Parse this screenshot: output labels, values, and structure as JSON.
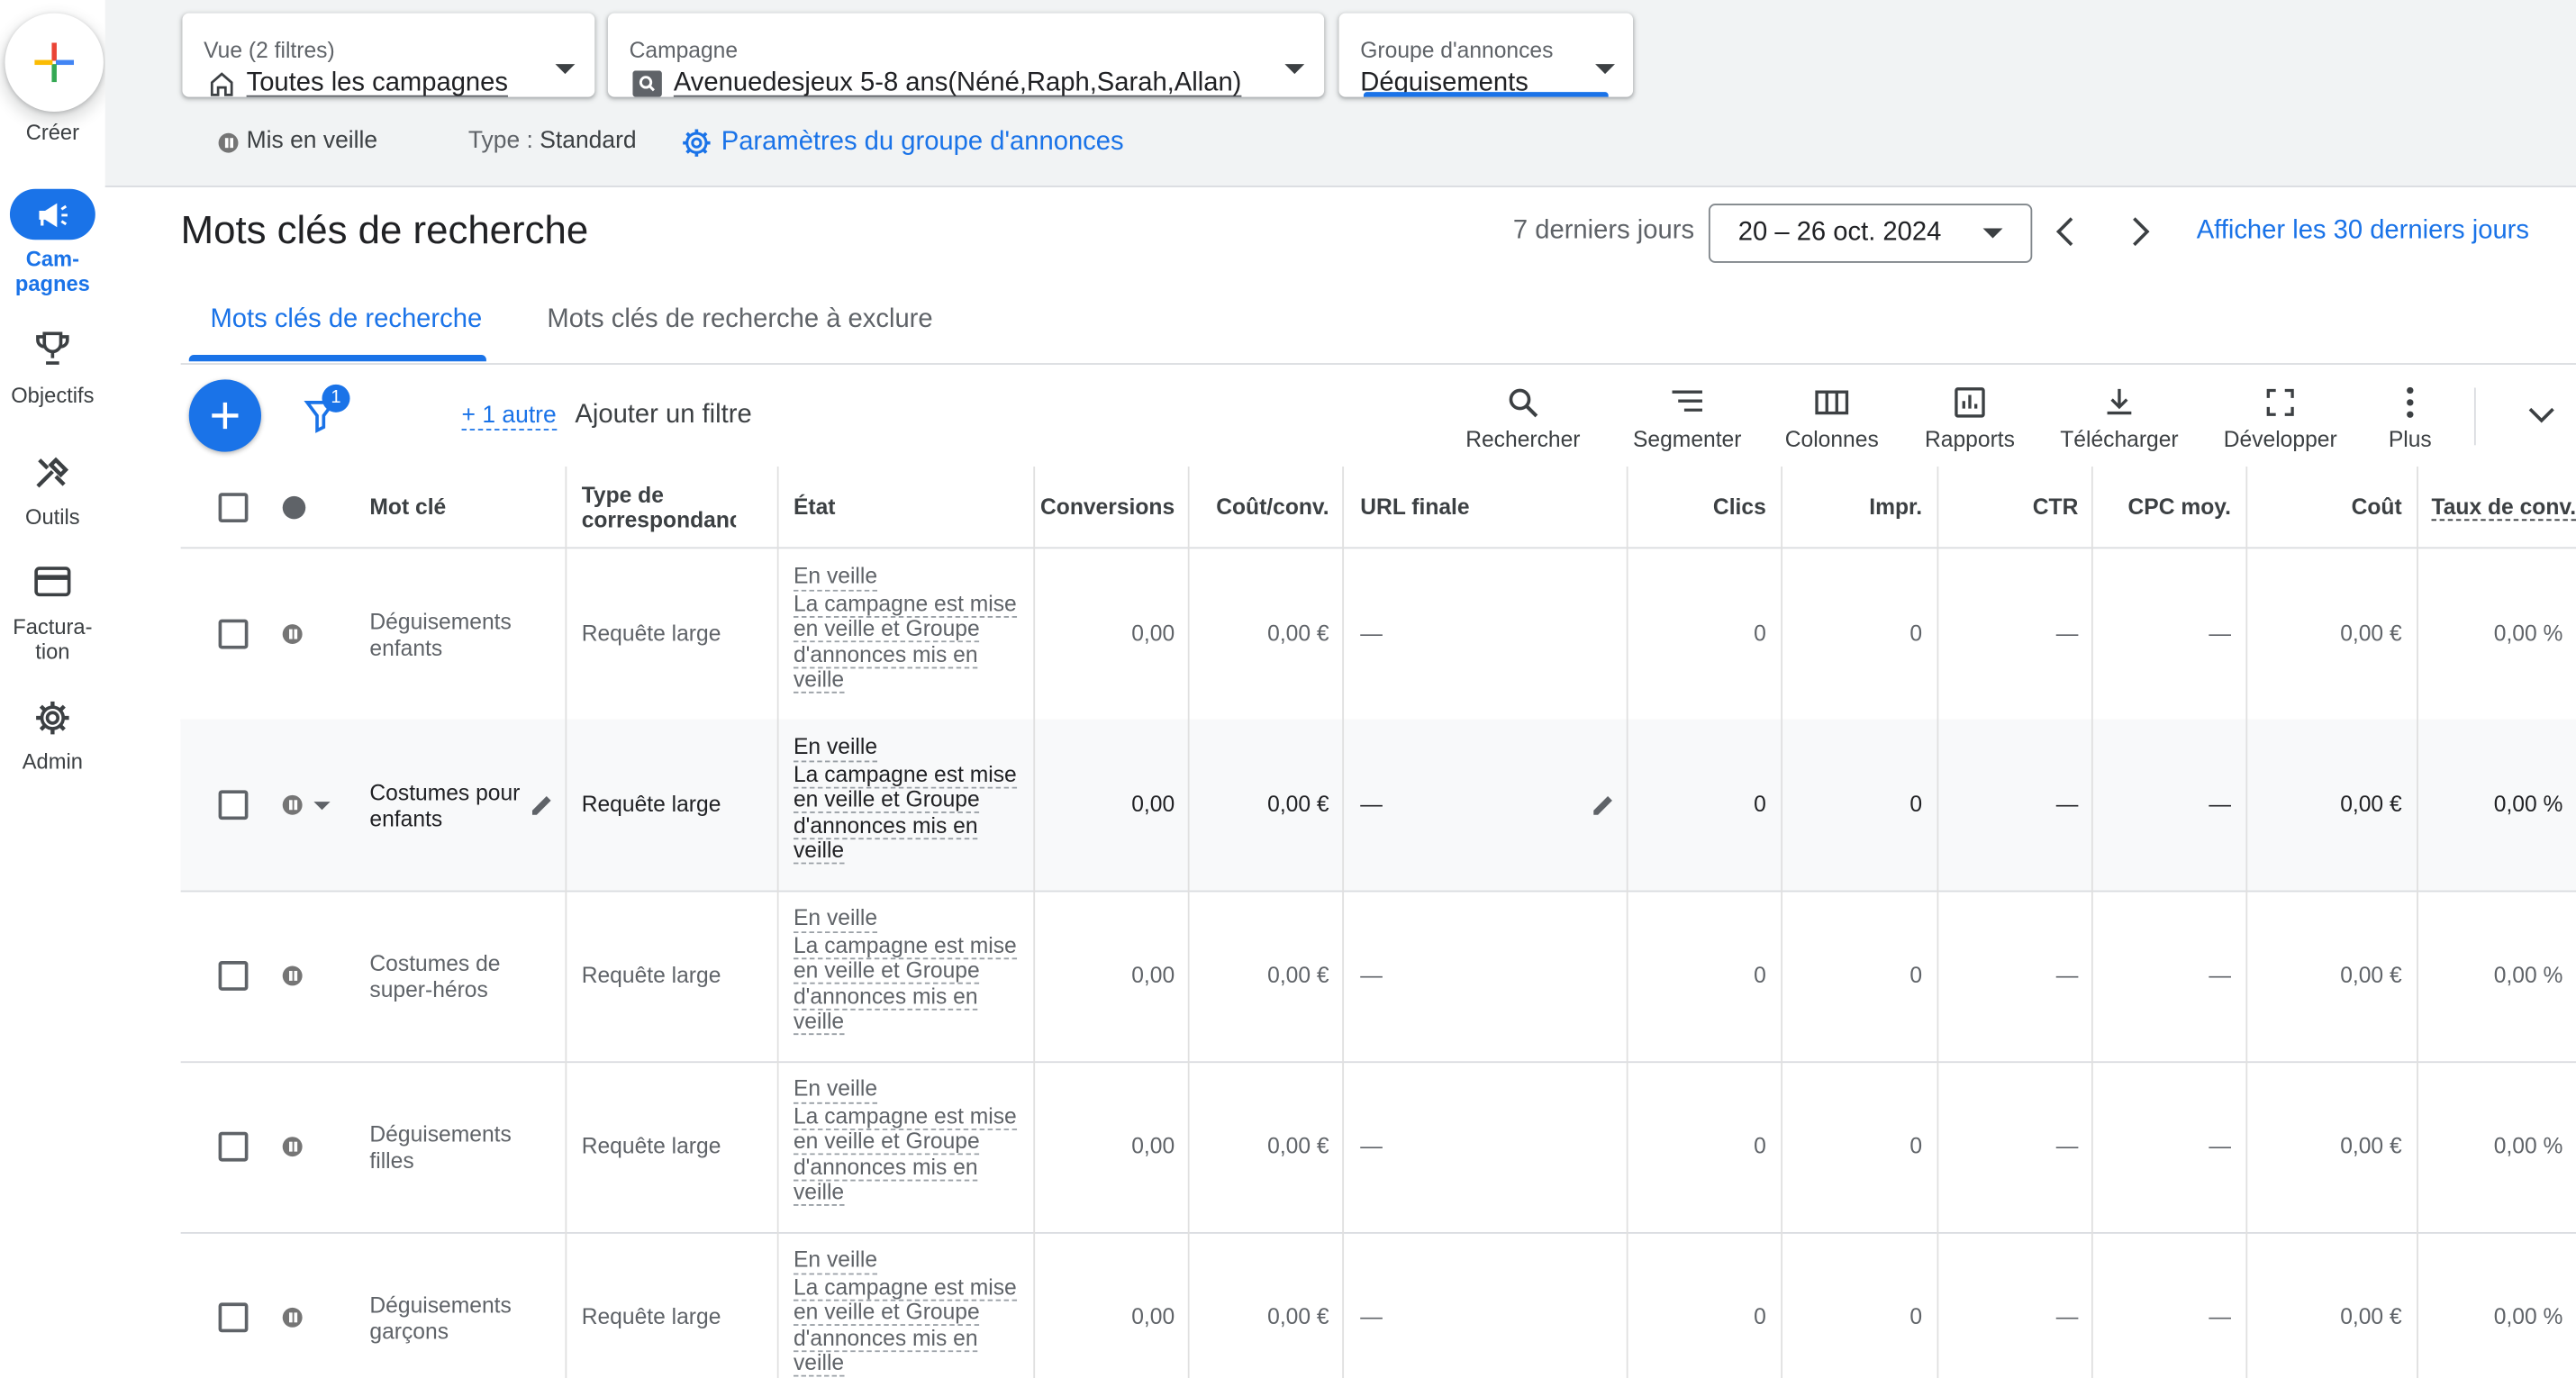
{
  "rail": {
    "create_label": "Créer",
    "items": [
      {
        "label": "Cam-\npagnes",
        "icon": "megaphone-icon",
        "active": true
      },
      {
        "label": "Objectifs",
        "icon": "trophy-icon"
      },
      {
        "label": "Outils",
        "icon": "tools-icon"
      },
      {
        "label": "Factura-\ntion",
        "icon": "credit-card-icon"
      },
      {
        "label": "Admin",
        "icon": "gear-icon"
      }
    ]
  },
  "pickers": {
    "view": {
      "label": "Vue (2 filtres)",
      "value": "Toutes les campagnes"
    },
    "campaign": {
      "label": "Campagne",
      "value": "Avenuedesjeux 5-8 ans(Néné,Raph,Sarah,Allan)"
    },
    "adgroup": {
      "label": "Groupe d'annonces",
      "value": "Déguisements"
    }
  },
  "status_row": {
    "status": "Mis en veille",
    "type_label": "Type :",
    "type_value": "Standard",
    "settings_link": "Paramètres du groupe d'annonces"
  },
  "header": {
    "title": "Mots clés de recherche",
    "range_label": "7 derniers jours",
    "date_range": "20 – 26 oct. 2024",
    "show_30_link": "Afficher les 30 derniers jours"
  },
  "tabs": [
    {
      "label": "Mots clés de recherche",
      "active": true
    },
    {
      "label": "Mots clés de recherche à exclure",
      "active": false
    }
  ],
  "toolbar": {
    "filter_badge": "1",
    "more_filters": "+ 1 autre",
    "add_filter": "Ajouter un filtre",
    "tools": [
      {
        "label": "Rechercher",
        "icon": "search-icon"
      },
      {
        "label": "Segmenter",
        "icon": "segment-icon"
      },
      {
        "label": "Colonnes",
        "icon": "columns-icon"
      },
      {
        "label": "Rapports",
        "icon": "reports-icon"
      },
      {
        "label": "Télécharger",
        "icon": "download-icon"
      },
      {
        "label": "Développer",
        "icon": "fullscreen-icon"
      },
      {
        "label": "Plus",
        "icon": "more-vert-icon"
      }
    ]
  },
  "table": {
    "columns": [
      "Mot clé",
      "Type de correspondance",
      "État",
      "Conversions",
      "Coût/conv.",
      "URL finale",
      "Clics",
      "Impr.",
      "CTR",
      "CPC moy.",
      "Coût",
      "Taux de conv."
    ],
    "rows": [
      {
        "keyword": "Déguisements enfants",
        "match": "Requête large",
        "state1": "En veille",
        "state2": "La campagne est mise en veille et Groupe d'annonces mis en veille",
        "conv": "0,00",
        "cost_conv": "0,00 €",
        "url": "—",
        "clicks": "0",
        "impr": "0",
        "ctr": "—",
        "cpc": "—",
        "cost": "0,00 €",
        "conv_rate": "0,00 %"
      },
      {
        "keyword": "Costumes pour enfants",
        "match": "Requête large",
        "state1": "En veille",
        "state2": "La campagne est mise en veille et Groupe d'annonces mis en veille",
        "conv": "0,00",
        "cost_conv": "0,00 €",
        "url": "—",
        "clicks": "0",
        "impr": "0",
        "ctr": "—",
        "cpc": "—",
        "cost": "0,00 €",
        "conv_rate": "0,00 %"
      },
      {
        "keyword": "Costumes de super-héros",
        "match": "Requête large",
        "state1": "En veille",
        "state2": "La campagne est mise en veille et Groupe d'annonces mis en veille",
        "conv": "0,00",
        "cost_conv": "0,00 €",
        "url": "—",
        "clicks": "0",
        "impr": "0",
        "ctr": "—",
        "cpc": "—",
        "cost": "0,00 €",
        "conv_rate": "0,00 %"
      },
      {
        "keyword": "Déguisements filles",
        "match": "Requête large",
        "state1": "En veille",
        "state2": "La campagne est mise en veille et Groupe d'annonces mis en veille",
        "conv": "0,00",
        "cost_conv": "0,00 €",
        "url": "—",
        "clicks": "0",
        "impr": "0",
        "ctr": "—",
        "cpc": "—",
        "cost": "0,00 €",
        "conv_rate": "0,00 %"
      },
      {
        "keyword": "Déguisements garçons",
        "match": "Requête large",
        "state1": "En veille",
        "state2": "La campagne est mise en veille et Groupe d'annonces mis en veille",
        "conv": "0,00",
        "cost_conv": "0,00 €",
        "url": "—",
        "clicks": "0",
        "impr": "0",
        "ctr": "—",
        "cpc": "—",
        "cost": "0,00 €",
        "conv_rate": "0,00 %"
      }
    ]
  },
  "colors": {
    "accent": "#1a73e8",
    "text": "#202124",
    "muted": "#5f6368",
    "bg_bar": "#f1f3f4"
  }
}
